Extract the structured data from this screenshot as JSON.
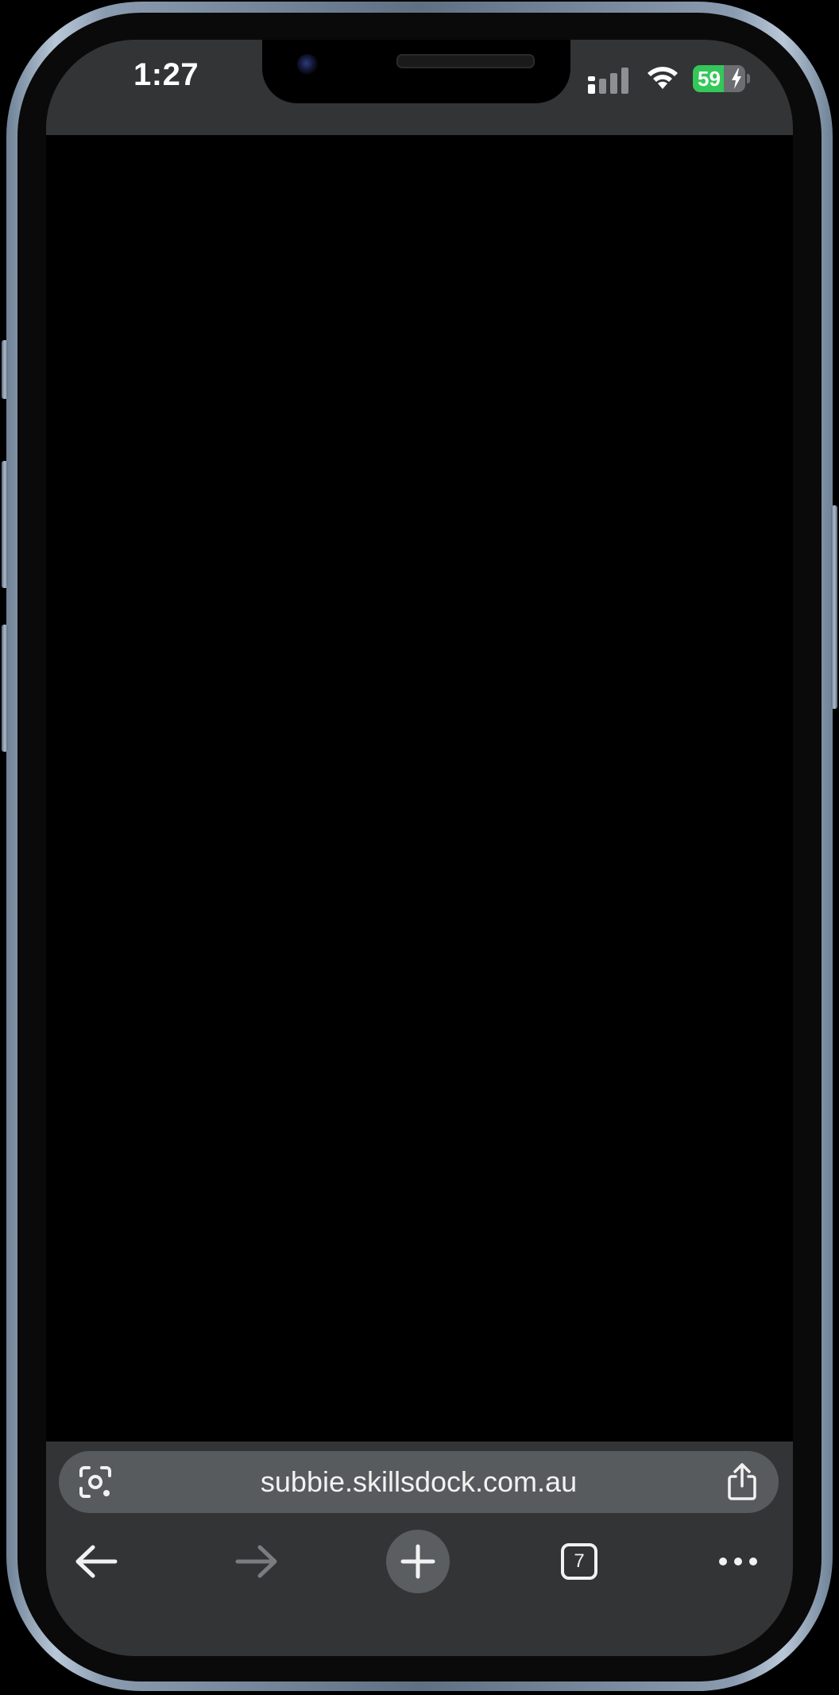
{
  "status_bar": {
    "time": "1:27",
    "battery_percent": "59",
    "battery_level": 0.59,
    "battery_charging": true,
    "signal_bars_active": 1,
    "signal_bars_total": 4
  },
  "browser": {
    "url": "subbie.skillsdock.com.au",
    "tab_count": "7",
    "forward_enabled": false
  },
  "colors": {
    "bar_background": "#323435",
    "address_pill": "#585b5d",
    "battery_green": "#34c759",
    "page_background": "#000000"
  },
  "icons": {
    "address_left": "google-lens-icon",
    "address_right": "share-icon",
    "nav": [
      "back-arrow-icon",
      "forward-arrow-icon",
      "plus-icon",
      "tab-switcher-icon",
      "more-options-icon"
    ]
  }
}
